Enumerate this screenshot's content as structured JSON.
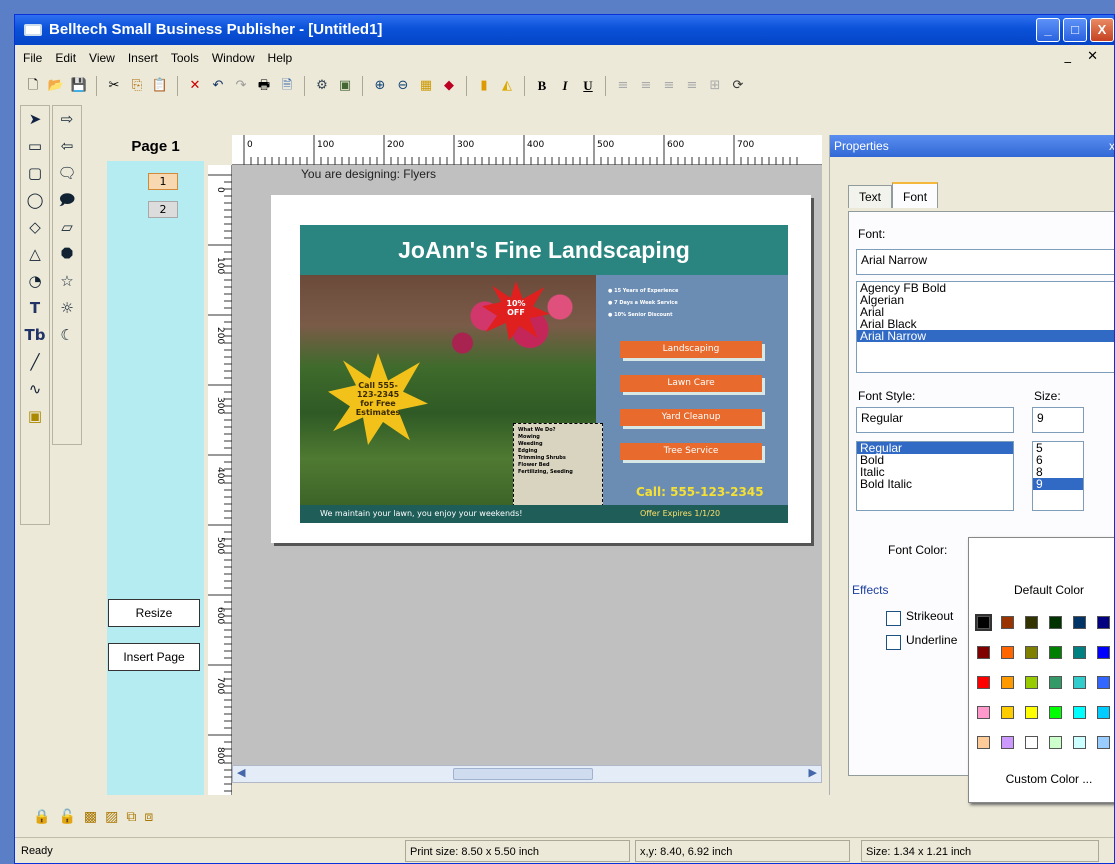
{
  "window": {
    "title": "Belltech Small Business Publisher - [Untitled1]",
    "min": "_",
    "max": "□",
    "close": "X"
  },
  "menu": [
    "File",
    "Edit",
    "View",
    "Insert",
    "Tools",
    "Window",
    "Help"
  ],
  "mdi_controls": "_ ✕",
  "format_toolbar": {
    "bold": "B",
    "italic": "I",
    "underline": "U"
  },
  "pages_panel": {
    "title": "Page 1",
    "pages": [
      "1",
      "2"
    ],
    "resize": "Resize",
    "insert_page": "Insert Page"
  },
  "rulers": {
    "h_ticks": [
      "0",
      "100",
      "200",
      "300",
      "400",
      "500",
      "600",
      "700"
    ],
    "v_ticks": [
      "0",
      "100",
      "200",
      "300",
      "400",
      "500",
      "600",
      "700",
      "800"
    ]
  },
  "canvas": {
    "designing": "You are designing: Flyers"
  },
  "flyer": {
    "title": "JoAnn's Fine Landscaping",
    "bullets": [
      "15 Years of Experience",
      "7 Days a Week Service",
      "10% Senior Discount"
    ],
    "badge": "10% OFF",
    "star_text": "Call 555-123-2345 for Free Estimates",
    "services": [
      "Landscaping",
      "Lawn Care",
      "Yard Cleanup",
      "Tree Service"
    ],
    "call": "Call: 555-123-2345",
    "footer": "We maintain your lawn, you enjoy your weekends!",
    "footer_right": "Offer Expires 1/1/20",
    "textbox_title": "What We Do?",
    "textbox_items": [
      "Mowing",
      "Weeding",
      "Edging",
      "Trimming Shrubs",
      "Flower Bed",
      "Fertilizing, Seeding"
    ]
  },
  "properties": {
    "header": "Properties",
    "close": "x",
    "tabs": [
      "Text",
      "Font"
    ],
    "font_label": "Font:",
    "font_value": "Arial Narrow",
    "fonts": [
      "Agency FB Bold",
      "Algerian",
      "Arial",
      "Arial Black",
      "Arial Narrow"
    ],
    "style_label": "Font Style:",
    "style_value": "Regular",
    "styles": [
      "Regular",
      "Bold",
      "Italic",
      "Bold Italic"
    ],
    "size_label": "Size:",
    "size_value": "9",
    "sizes": [
      "5",
      "6",
      "8",
      "9"
    ],
    "font_color_label": "Font Color:",
    "effects_label": "Effects",
    "effects": [
      "Strikeout",
      "Underline"
    ]
  },
  "color_picker": {
    "default": "Default Color",
    "custom": "Custom Color ...",
    "rows": [
      [
        "#000000",
        "#993300",
        "#333300",
        "#003300",
        "#003366",
        "#000080"
      ],
      [
        "#800000",
        "#ff6600",
        "#808000",
        "#008000",
        "#008080",
        "#0000ff"
      ],
      [
        "#ff0000",
        "#ff9900",
        "#99cc00",
        "#339966",
        "#33cccc",
        "#3366ff"
      ],
      [
        "#ff99cc",
        "#ffcc00",
        "#ffff00",
        "#00ff00",
        "#00ffff",
        "#00ccff"
      ],
      [
        "#ffcc99",
        "#cc99ff",
        "#ffffff",
        "#ccffcc",
        "#ccffff",
        "#99ccff"
      ]
    ]
  },
  "status": {
    "ready": "Ready",
    "print_size": "Print size: 8.50 x 5.50 inch",
    "xy": "x,y: 8.40, 6.92 inch",
    "size": "Size: 1.34 x 1.21 inch"
  }
}
